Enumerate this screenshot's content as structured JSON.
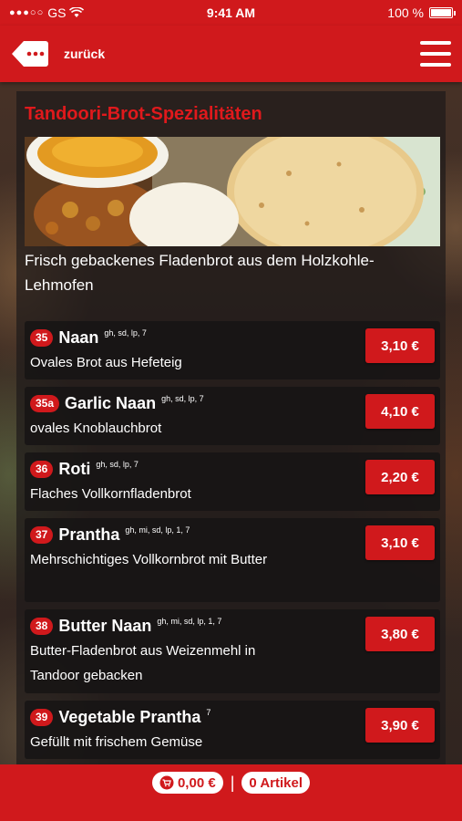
{
  "status_bar": {
    "carrier": "GS",
    "time": "9:41 AM",
    "battery": "100 %"
  },
  "nav": {
    "back_label": "zurück"
  },
  "section": {
    "title": "Tandoori-Brot-Spezialitäten",
    "description": "Frisch gebackenes Fladenbrot aus dem Holzkohle-Lehmofen"
  },
  "items": [
    {
      "number": "35",
      "name": "Naan",
      "codes": "gh, sd, lp, 7",
      "description": "Ovales Brot aus Hefeteig",
      "price": "3,10 €"
    },
    {
      "number": "35a",
      "name": "Garlic Naan",
      "codes": "gh, sd, lp, 7",
      "description": "ovales Knoblauchbrot",
      "price": "4,10 €"
    },
    {
      "number": "36",
      "name": "Roti",
      "codes": "gh, sd, lp, 7",
      "description": "Flaches Vollkornfladenbrot",
      "price": "2,20 €"
    },
    {
      "number": "37",
      "name": "Prantha",
      "codes": "gh, mi, sd, lp, 1, 7",
      "description": "Mehrschichtiges Vollkornbrot mit Butter",
      "price": "3,10 €"
    },
    {
      "number": "38",
      "name": "Butter Naan",
      "codes": "gh, mi, sd, lp, 1, 7",
      "description": "Butter-Fladenbrot aus Weizenmehl in Tandoor gebacken",
      "price": "3,80 €"
    },
    {
      "number": "39",
      "name": "Vegetable Prantha",
      "codes": "7",
      "description": "Gefüllt mit frischem Gemüse",
      "price": "3,90 €"
    }
  ],
  "cart": {
    "total": "0,00 €",
    "separator": "|",
    "count": "0 Artikel"
  },
  "colors": {
    "accent": "#d0191c"
  }
}
